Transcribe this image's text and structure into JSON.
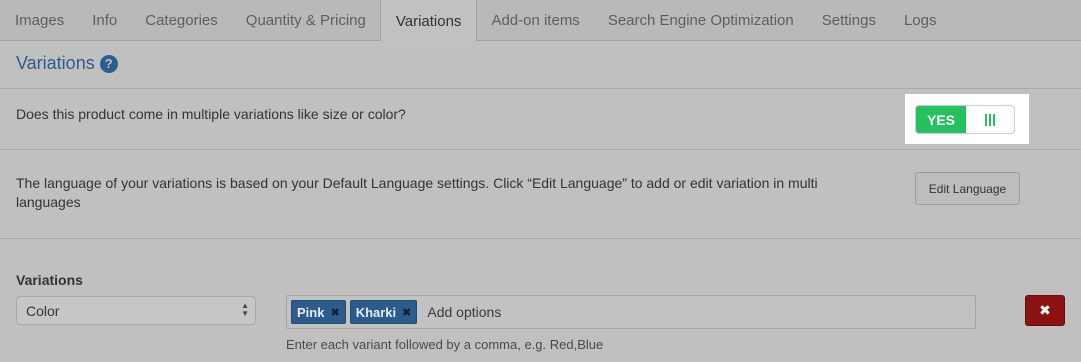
{
  "tabs": [
    {
      "label": "Images",
      "active": false
    },
    {
      "label": "Info",
      "active": false
    },
    {
      "label": "Categories",
      "active": false
    },
    {
      "label": "Quantity & Pricing",
      "active": false
    },
    {
      "label": "Variations",
      "active": true
    },
    {
      "label": "Add-on items",
      "active": false
    },
    {
      "label": "Search Engine Optimization",
      "active": false
    },
    {
      "label": "Settings",
      "active": false
    },
    {
      "label": "Logs",
      "active": false
    }
  ],
  "section": {
    "title": "Variations",
    "help_icon": "?"
  },
  "multi_variation": {
    "question": "Does this product come in multiple variations like size or color?",
    "toggle_label": "YES",
    "toggle_on": true
  },
  "language": {
    "text": "The language of your variations is based on your Default Language settings. Click “Edit Language” to add or edit variation in multi languages",
    "button_label": "Edit Language"
  },
  "variations": {
    "label": "Variations",
    "type_select_value": "Color",
    "options": [
      "Pink",
      "Kharki"
    ],
    "tag_remove_glyph": "✖",
    "input_placeholder": "Add options",
    "hint": "Enter each variant followed by a comma, e.g. Red,Blue",
    "delete_glyph": "✖"
  },
  "colors": {
    "link_blue": "#2d5c8e",
    "toggle_green": "#26c060",
    "tag_blue": "#2d5b8b",
    "delete_red": "#8a1212"
  }
}
